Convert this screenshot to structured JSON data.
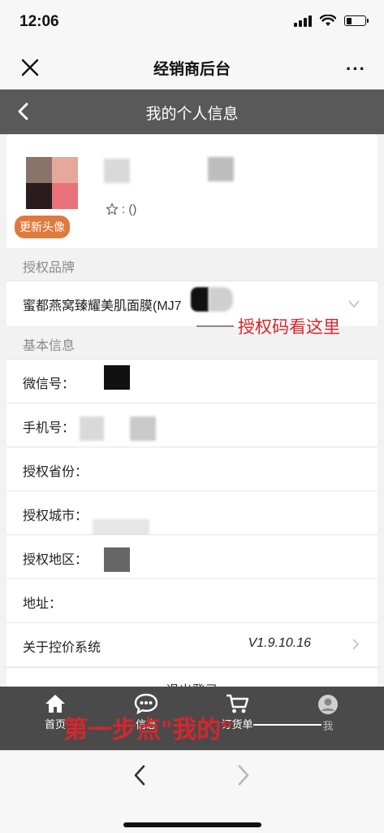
{
  "status_bar": {
    "time": "12:06",
    "battery_level": 0.3
  },
  "wechat_nav": {
    "title": "经销商后台",
    "more": "···",
    "close_icon": "close-icon"
  },
  "header": {
    "title": "我的个人信息"
  },
  "profile": {
    "update_avatar_label": "更新头像",
    "rating_text": ":  ()",
    "avatar_colors": [
      "#8a7368",
      "#e6a89b",
      "#2a1c1c",
      "#e8717a"
    ]
  },
  "sections": {
    "authorized_brand": "授权品牌",
    "basic_info": "基本信息"
  },
  "brand_row": {
    "value": "蜜都燕窝臻耀美肌面膜(MJ7"
  },
  "fields": {
    "wechat": "微信号：",
    "phone": "手机号：",
    "province": "授权省份：",
    "city": "授权城市：",
    "district": "授权地区：",
    "address": "地址："
  },
  "about": {
    "label": "关于控价系统",
    "version": "V1.9.10.16"
  },
  "logout_label": "退出登录",
  "tabs": [
    {
      "label": "首页"
    },
    {
      "label": "信息"
    },
    {
      "label": "订货单"
    },
    {
      "label": "我"
    }
  ],
  "annotations": {
    "auth_code": "授权码看这里",
    "step_one": "第一步点\"我的\""
  },
  "colors": {
    "accent_orange": "#e07a3c",
    "annotation_red": "#d6262c",
    "header_gray": "#595959"
  }
}
